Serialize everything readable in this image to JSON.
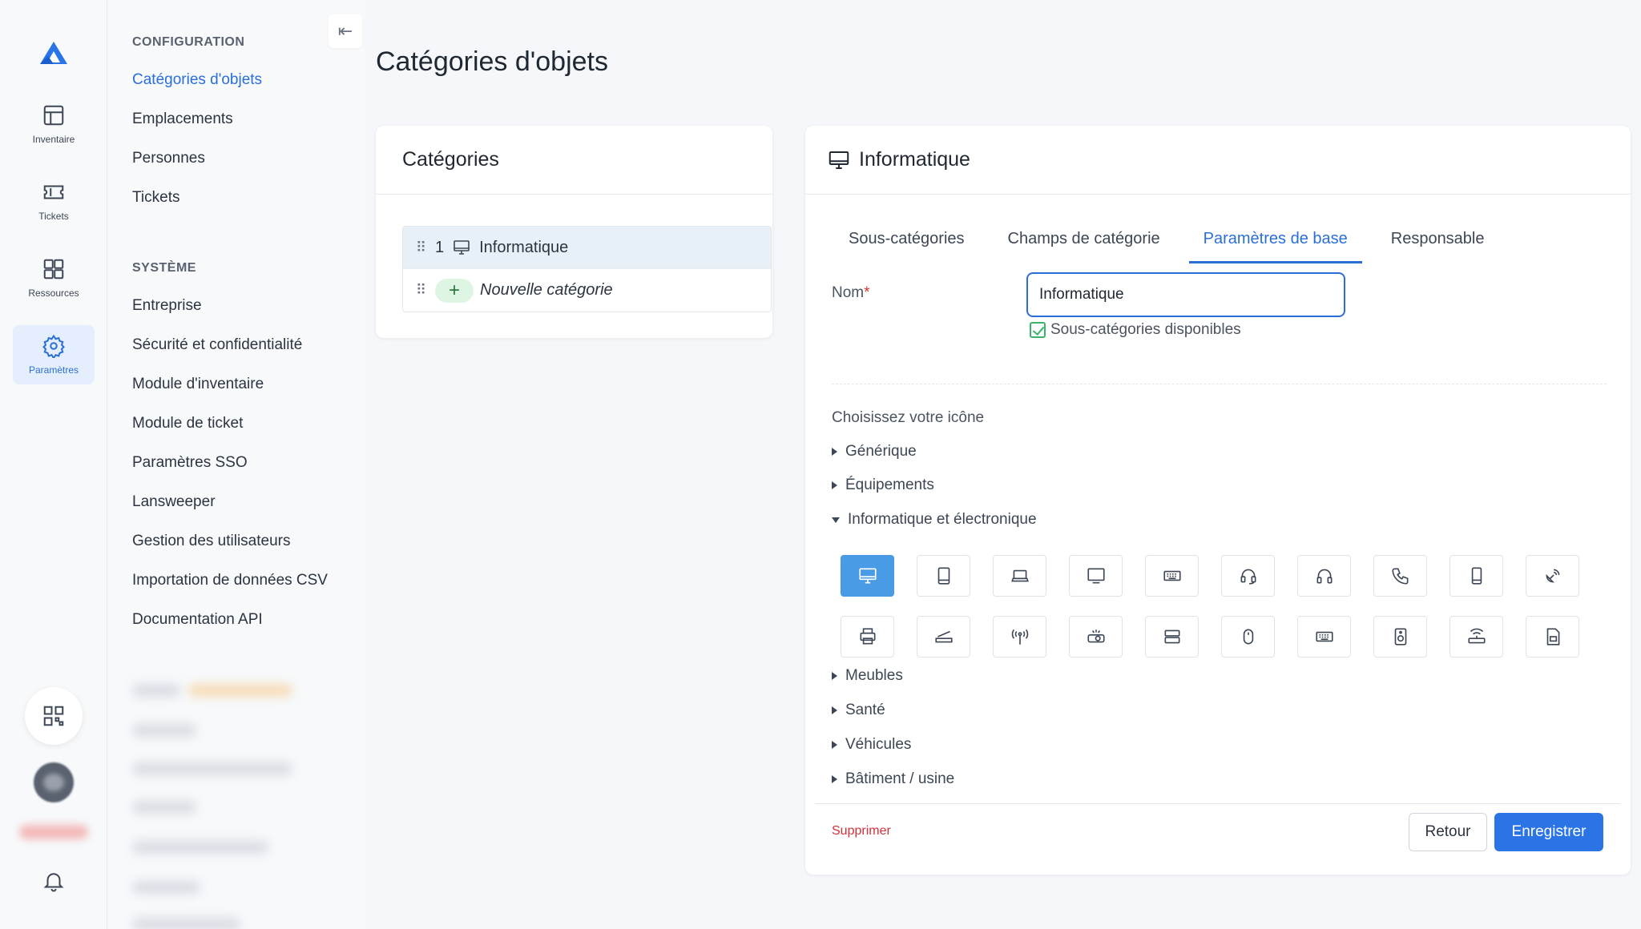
{
  "rail": {
    "items": [
      {
        "label": "Inventaire",
        "icon": "grid-icon"
      },
      {
        "label": "Tickets",
        "icon": "ticket-icon"
      },
      {
        "label": "Ressources",
        "icon": "resources-icon"
      },
      {
        "label": "Paramètres",
        "icon": "gear-icon"
      }
    ]
  },
  "sidebar": {
    "section_config": "CONFIGURATION",
    "config_items": [
      "Catégories d'objets",
      "Emplacements",
      "Personnes",
      "Tickets"
    ],
    "section_system": "SYSTÈME",
    "system_items": [
      "Entreprise",
      "Sécurité et confidentialité",
      "Module d'inventaire",
      "Module de ticket",
      "Paramètres SSO",
      "Lansweeper",
      "Gestion des utilisateurs",
      "Importation de données CSV",
      "Documentation API"
    ]
  },
  "page": {
    "title": "Catégories d'objets"
  },
  "categories": {
    "title": "Catégories",
    "rows": [
      {
        "index": "1",
        "name": "Informatique"
      }
    ],
    "new_label": "Nouvelle catégorie"
  },
  "detail": {
    "title": "Informatique",
    "tabs": [
      "Sous-catégories",
      "Champs de catégorie",
      "Paramètres de base",
      "Responsable"
    ],
    "active_tab": 2,
    "name_label": "Nom",
    "required_mark": "*",
    "name_value": "Informatique",
    "subcat_label": "Sous-catégories disponibles",
    "choose_icon": "Choisissez votre icône",
    "groups_before": [
      "Générique",
      "Équipements"
    ],
    "open_group": "Informatique et électronique",
    "groups_after": [
      "Meubles",
      "Santé",
      "Véhicules",
      "Bâtiment / usine"
    ],
    "icons": [
      "desktop-icon",
      "tablet-icon",
      "laptop-icon",
      "monitor-icon",
      "keyboard-icon",
      "headset-icon",
      "headphones-icon",
      "phone-icon",
      "mobile-icon",
      "satellite-icon",
      "printer-icon",
      "scanner-icon",
      "antenna-icon",
      "projector-icon",
      "server-icon",
      "mouse-icon",
      "keyboard-alt-icon",
      "speaker-icon",
      "router-icon",
      "sim-card-icon"
    ],
    "delete_label": "Supprimer",
    "back_label": "Retour",
    "save_label": "Enregistrer"
  },
  "colors": {
    "accent": "#2b6fd6",
    "selected_icon": "#4a9be6",
    "danger": "#d0313a"
  }
}
